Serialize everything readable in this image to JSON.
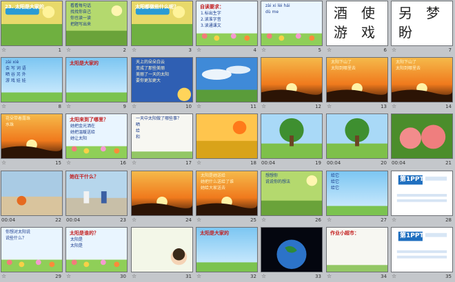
{
  "slides": [
    {
      "n": "1",
      "title": "23. 太阳是大家的",
      "sub": "",
      "dur": ""
    },
    {
      "n": "2",
      "lines": [
        "看看每句话",
        "找找你自己",
        "你也读一读",
        "把题写出来"
      ],
      "dur": ""
    },
    {
      "n": "3",
      "title": "太阳都做些什么呢？",
      "dur": ""
    },
    {
      "n": "4",
      "title": "自读要求：",
      "lines": [
        "1.标出生字",
        "2.读准字音",
        "3.读通课文"
      ],
      "dur": ""
    },
    {
      "n": "5",
      "lines": [
        "zài xi lèi hái",
        "dù me"
      ],
      "dur": ""
    },
    {
      "n": "6",
      "chars": [
        "酒",
        "使",
        "游",
        "戏"
      ],
      "dur": ""
    },
    {
      "n": "7",
      "chars": [
        "另",
        "梦",
        "盼",
        ""
      ],
      "dur": ""
    },
    {
      "n": "8",
      "lines": [
        "zài xiè",
        "会 写 词 语",
        "晒 谷 另 外",
        "游 戏 娃 娃"
      ],
      "dur": ""
    },
    {
      "n": "9",
      "title": "太阳是大家的",
      "dur": ""
    },
    {
      "n": "10",
      "lines": [
        "天上的朵朵白云",
        "变成了那些美丽",
        "美丽了一天的太阳",
        "要你更加更大"
      ],
      "dur": ""
    },
    {
      "n": "11",
      "dur": ""
    },
    {
      "n": "12",
      "dur": ""
    },
    {
      "n": "13",
      "lines": [
        "太阳下山了",
        "太阳到哪里去"
      ],
      "dur": ""
    },
    {
      "n": "14",
      "lines": [
        "太阳下山了",
        "太阳到哪里去"
      ],
      "dur": ""
    },
    {
      "n": "15",
      "lines": [
        "花朵带着露珠",
        "水珠"
      ],
      "dur": ""
    },
    {
      "n": "16",
      "title": "太阳来到了哪里？",
      "lines": [
        "她把金光洒在",
        "她把温暖送给",
        "她让太阳"
      ],
      "dur": ""
    },
    {
      "n": "17",
      "lines": [
        "一天中太阳做了哪些事？",
        "晒",
        "给",
        "和"
      ],
      "dur": ""
    },
    {
      "n": "18",
      "dur": ""
    },
    {
      "n": "19",
      "dur": "00:04"
    },
    {
      "n": "20",
      "dur": "00:04"
    },
    {
      "n": "21",
      "dur": "00:04"
    },
    {
      "n": "22",
      "dur": "00:04"
    },
    {
      "n": "23",
      "title": "她在干什么？",
      "dur": "00:04"
    },
    {
      "n": "24",
      "dur": ""
    },
    {
      "n": "25",
      "lines": [
        "太阳是她送给",
        "她把什么送给了谁",
        "她给大家送去"
      ],
      "dur": ""
    },
    {
      "n": "26",
      "lines": [
        "想想你",
        "说说你的想法"
      ],
      "dur": ""
    },
    {
      "n": "27",
      "lines": [
        "给它",
        "给它",
        "给它"
      ],
      "dur": ""
    },
    {
      "n": "28",
      "brand": "第1PPT",
      "dur": ""
    },
    {
      "n": "29",
      "lines": [
        "你想对太阳说",
        "说些什么？"
      ],
      "dur": ""
    },
    {
      "n": "30",
      "title": "太阳是谁的？",
      "lines": [
        "太阳是",
        "太阳是"
      ],
      "dur": ""
    },
    {
      "n": "31",
      "dur": ""
    },
    {
      "n": "32",
      "title": "太阳是大家的",
      "dur": ""
    },
    {
      "n": "33",
      "dur": ""
    },
    {
      "n": "34",
      "title": "作业小超市：",
      "dur": ""
    },
    {
      "n": "35",
      "brand": "第1PPT",
      "dur": ""
    }
  ],
  "ui": {
    "star_glyph": "☆"
  }
}
